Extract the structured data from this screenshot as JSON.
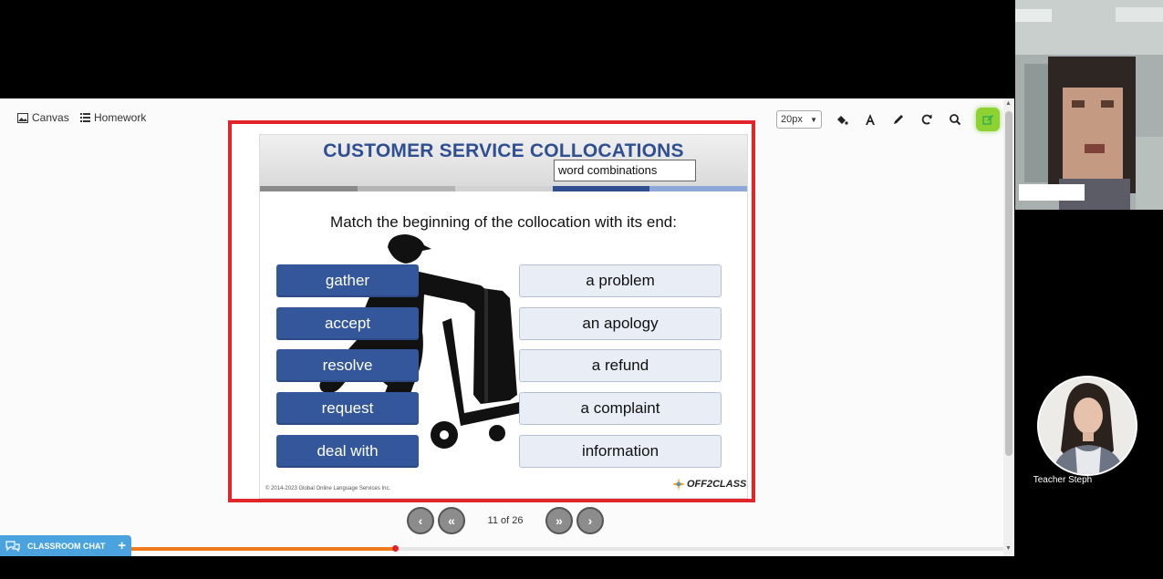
{
  "nav": {
    "canvas_label": "Canvas",
    "homework_label": "Homework"
  },
  "toolbar": {
    "font_size": "20px",
    "tools": [
      "paint-bucket-icon",
      "text-icon",
      "pencil-icon",
      "refresh-icon",
      "search-icon",
      "edit-icon"
    ]
  },
  "slide": {
    "title": "CUSTOMER SERVICE COLLOCATIONS",
    "annotation": "word combinations",
    "instruction": "Match the beginning of the collocation with its end:",
    "left_words": [
      "gather",
      "accept",
      "resolve",
      "request",
      "deal with"
    ],
    "right_words": [
      "a problem",
      "an apology",
      "a refund",
      "a complaint",
      "information"
    ],
    "copyright": "© 2014-2023 Global Online Language Services Inc.",
    "brand": "OFF2CLASS"
  },
  "pager": {
    "indicator": "11 of 26",
    "current": 11,
    "total": 26
  },
  "progress": {
    "fraction": 0.3
  },
  "chat": {
    "label": "CLASSROOM CHAT"
  },
  "teacher": {
    "name": "Teacher Steph"
  },
  "colors": {
    "accent_red": "#e2252b",
    "word_blue": "#34579c",
    "progress_orange": "#f07a1e",
    "chat_blue": "#4aa3df",
    "active_tool_green": "#8ed232"
  }
}
